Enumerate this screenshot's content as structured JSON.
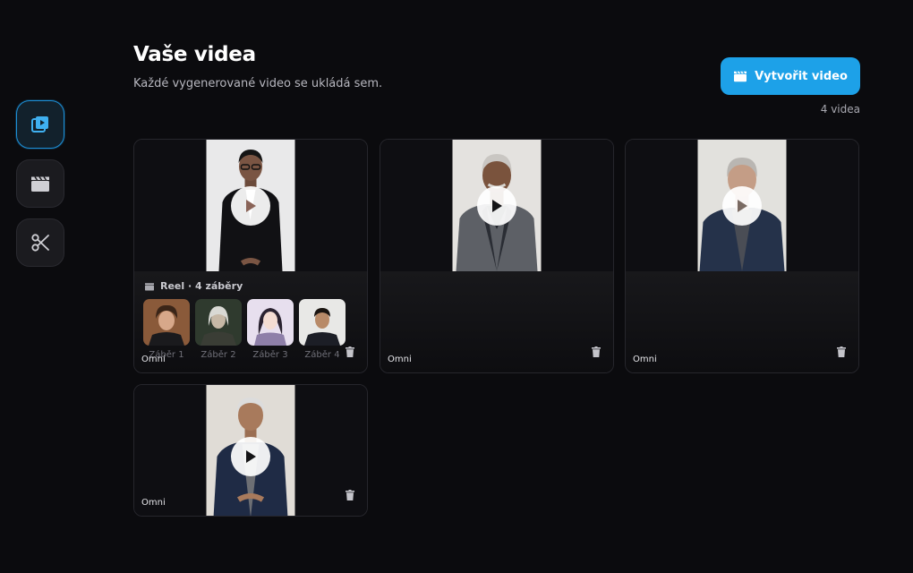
{
  "header": {
    "title": "Vaše videa",
    "subtitle": "Každé vygenerované video se ukládá sem."
  },
  "actions": {
    "create_label": "Vytvořit video",
    "video_count": "4 videa"
  },
  "sidebar": {
    "items": [
      {
        "name": "videos",
        "icon": "video-library-icon",
        "active": true
      },
      {
        "name": "create",
        "icon": "clapperboard-icon",
        "active": false
      },
      {
        "name": "edit",
        "icon": "scissors-icon",
        "active": false
      }
    ]
  },
  "videos": [
    {
      "model": "Omni",
      "reel": {
        "label": "Reel · 4 záběry",
        "shots": [
          "Záběr 1",
          "Záběr 2",
          "Záběr 3",
          "Záběr 4"
        ]
      }
    },
    {
      "model": "Omni"
    },
    {
      "model": "Omni"
    },
    {
      "model": "Omni"
    }
  ],
  "colors": {
    "accent": "#1da1e8",
    "background": "#0b0b0e",
    "card": "#111114"
  }
}
